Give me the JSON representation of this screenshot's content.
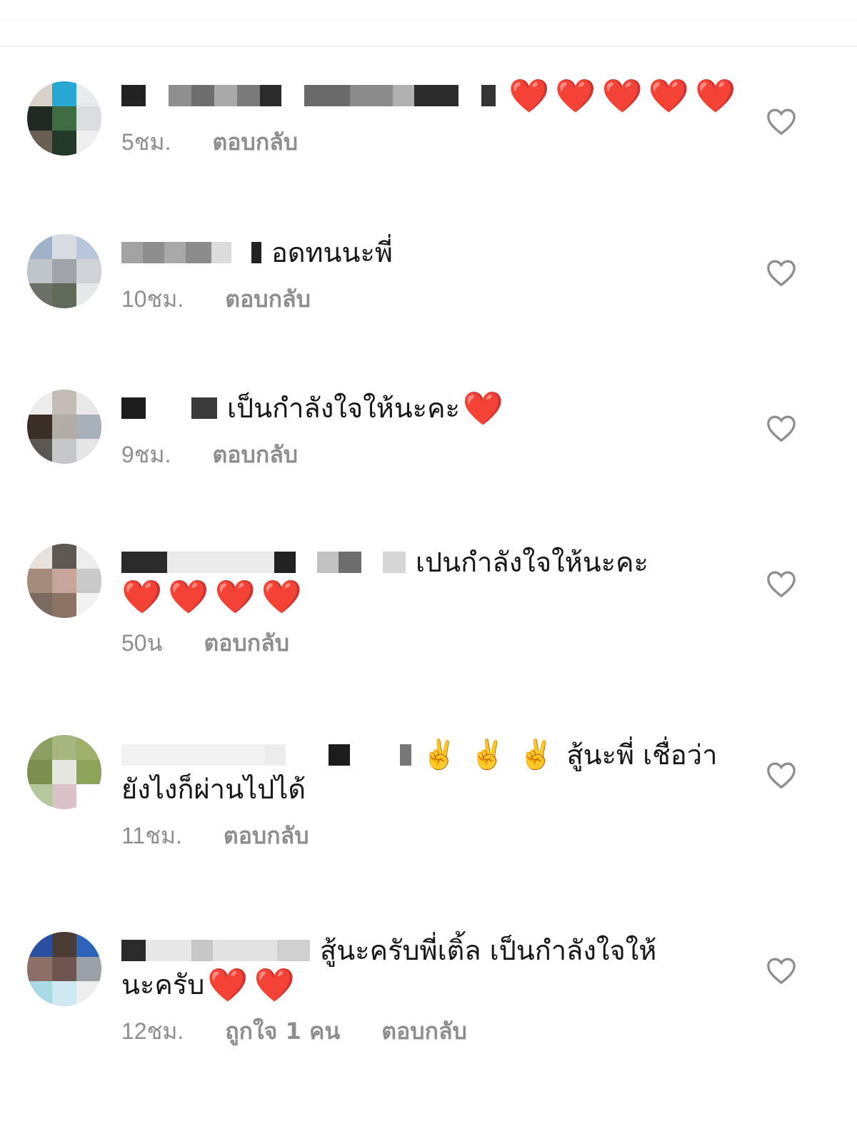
{
  "comments": [
    {
      "text": "",
      "hearts": [
        "❤️",
        "❤️",
        "❤️",
        "❤️",
        "❤️"
      ],
      "time": "5ชม.",
      "reply": "ตอบกลับ"
    },
    {
      "text": "อดทนนะพี่",
      "time": "10ชม.",
      "reply": "ตอบกลับ"
    },
    {
      "text": "เป็นกำลังใจให้นะคะ",
      "hearts": [
        "❤️"
      ],
      "time": "9ชม.",
      "reply": "ตอบกลับ"
    },
    {
      "text": "เปนกำลังใจให้นะคะ",
      "hearts": [
        "❤️",
        "❤️",
        "❤️",
        "❤️"
      ],
      "time": "50น",
      "reply": "ตอบกลับ"
    },
    {
      "peace": [
        "✌️",
        "✌️",
        "✌️"
      ],
      "text": "สู้นะพี่ เชื่อว่า",
      "text2": "ยังไงก็ผ่านไปได้",
      "time": "11ชม.",
      "reply": "ตอบกลับ"
    },
    {
      "text": "สู้นะครับพี่เติ้ล เป็นกำลังใจให้",
      "text2": "นะครับ",
      "hearts": [
        "❤️",
        "❤️"
      ],
      "time": "12ชม.",
      "likes": "ถูกใจ 1 คน",
      "reply": "ตอบกลับ"
    }
  ],
  "icons": {
    "like": "heart-outline-icon",
    "reply_heart": "red-heart-emoji"
  },
  "colors": {
    "meta": "#8e8e8e",
    "heart": "#e8202a"
  }
}
